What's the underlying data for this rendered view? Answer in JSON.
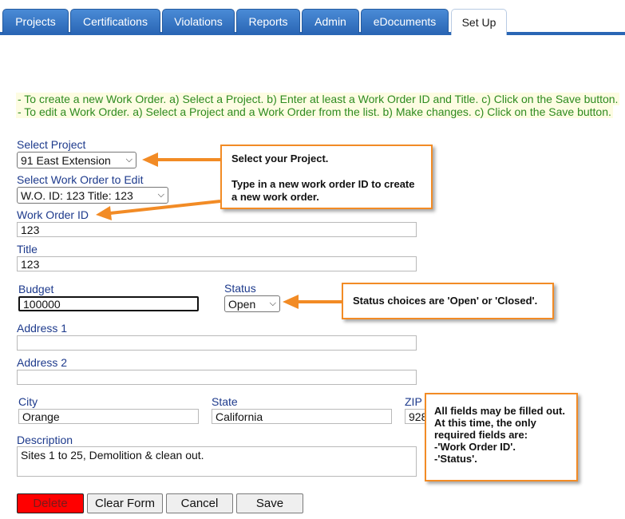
{
  "tabs": [
    {
      "label": "Projects"
    },
    {
      "label": "Certifications"
    },
    {
      "label": "Violations"
    },
    {
      "label": "Reports"
    },
    {
      "label": "Admin"
    },
    {
      "label": "eDocuments"
    },
    {
      "label": "Set Up"
    }
  ],
  "instructions": {
    "line1": "- To create a new Work Order. a) Select a Project. b) Enter at least a Work Order ID and Title. c) Click on the Save button.",
    "line2": "- To edit a Work Order. a) Select a Project and a Work Order from the list. b) Make changes. c) Click on the Save button."
  },
  "form": {
    "select_project_label": "Select Project",
    "select_project_value": "91 East Extension",
    "select_wo_label": "Select Work Order to Edit",
    "select_wo_value": "W.O. ID: 123 Title: 123",
    "work_order_id_label": "Work Order ID",
    "work_order_id_value": "123",
    "title_label": "Title",
    "title_value": "123",
    "budget_label": "Budget",
    "budget_value": "100000",
    "status_label": "Status",
    "status_value": "Open",
    "address1_label": "Address 1",
    "address1_value": "",
    "address2_label": "Address 2",
    "address2_value": "",
    "city_label": "City",
    "city_value": "Orange",
    "state_label": "State",
    "state_value": "California",
    "zip_label": "ZIP",
    "zip_value": "928",
    "description_label": "Description",
    "description_value": "Sites 1 to 25, Demolition & clean out."
  },
  "buttons": {
    "delete": "Delete",
    "clear": "Clear Form",
    "cancel": "Cancel",
    "save": "Save"
  },
  "callouts": {
    "project_line1": "Select your Project.",
    "project_line2": "Type in a new work order ID to create a new work order.",
    "status": "Status choices are 'Open' or 'Closed'.",
    "fields_line1": "All fields may be filled out.",
    "fields_line2": "At this time, the only required fields are:",
    "fields_line3": "-'Work Order ID'.",
    "fields_line4": "-'Status'."
  },
  "colors": {
    "tab_blue": "#2a66b5",
    "label_blue": "#1d3a8c",
    "instruction_green": "#2e8b20",
    "callout_orange": "#f28b25",
    "delete_red": "#ff0000"
  }
}
